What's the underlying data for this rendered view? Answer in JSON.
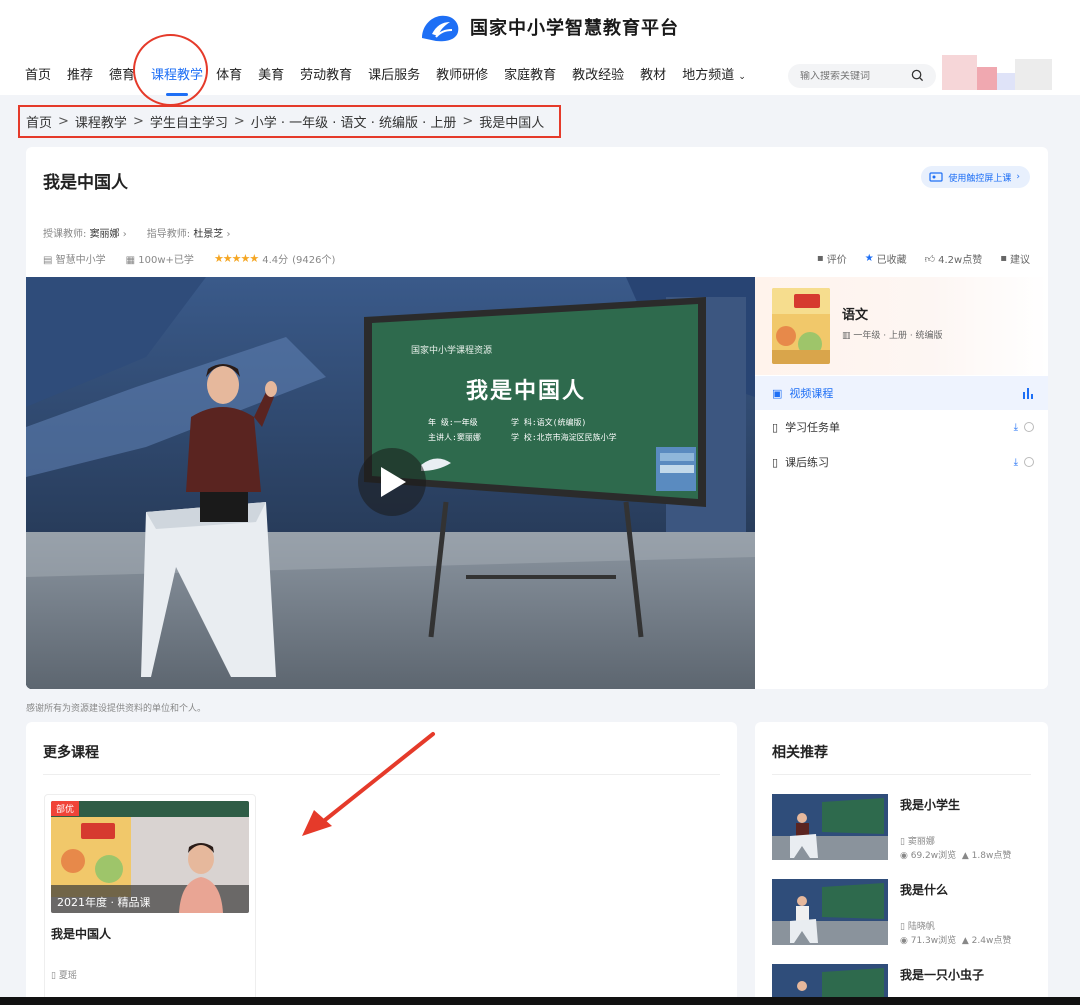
{
  "header": {
    "site_title": "国家中小学智慧教育平台",
    "nav": [
      "首页",
      "推荐",
      "德育",
      "课程教学",
      "体育",
      "美育",
      "劳动教育",
      "课后服务",
      "教师研修",
      "家庭教育",
      "教改经验",
      "教材",
      "地方频道"
    ],
    "active_nav": "课程教学",
    "search_placeholder": "输入搜索关键词"
  },
  "breadcrumb": [
    "首页",
    "课程教学",
    "学生自主学习",
    "小学 · 一年级 · 语文 · 统编版 · 上册",
    "我是中国人"
  ],
  "course": {
    "title": "我是中国人",
    "touch_button": "使用触控屏上课",
    "teacher_label": "授课教师:",
    "teacher": "窦丽娜",
    "advisor_label": "指导教师:",
    "advisor": "杜景芝",
    "platform": "智慧中小学",
    "learners": "100w+已学",
    "rating": "4.4分",
    "rating_count": "(9426个)",
    "actions": {
      "review": "评价",
      "favorite": "已收藏",
      "likes": "4.2w点赞",
      "suggest": "建议"
    }
  },
  "video": {
    "board_header": "国家中小学课程资源",
    "board_title": "我是中国人",
    "board_line1a": "年  级:一年级",
    "board_line1b": "学  科:语文(统编版)",
    "board_line2a": "主讲人:窦丽娜",
    "board_line2b": "学  校:北京市海淀区民族小学"
  },
  "sidebar": {
    "book_name": "语文",
    "book_desc": "一年级 · 上册 · 统编版",
    "items": [
      {
        "label": "视频课程",
        "active": true
      },
      {
        "label": "学习任务单",
        "active": false
      },
      {
        "label": "课后练习",
        "active": false
      }
    ]
  },
  "thanks": "感谢所有为资源建设提供资料的单位和个人。",
  "more_courses": {
    "title": "更多课程",
    "items": [
      {
        "tag": "部优",
        "year_label": "2021年度 · 精品课",
        "title": "我是中国人",
        "author": "夏瑶"
      }
    ]
  },
  "related": {
    "title": "相关推荐",
    "items": [
      {
        "title": "我是小学生",
        "author": "窦丽娜",
        "views": "69.2w浏览",
        "likes": "1.8w点赞"
      },
      {
        "title": "我是什么",
        "author": "陆晓帆",
        "views": "71.3w浏览",
        "likes": "2.4w点赞"
      },
      {
        "title": "我是一只小虫子",
        "author": "",
        "views": "",
        "likes": ""
      }
    ]
  },
  "colors": {
    "accent": "#1e6ff5",
    "annotation": "#e53a2a",
    "star": "#f5a623"
  }
}
